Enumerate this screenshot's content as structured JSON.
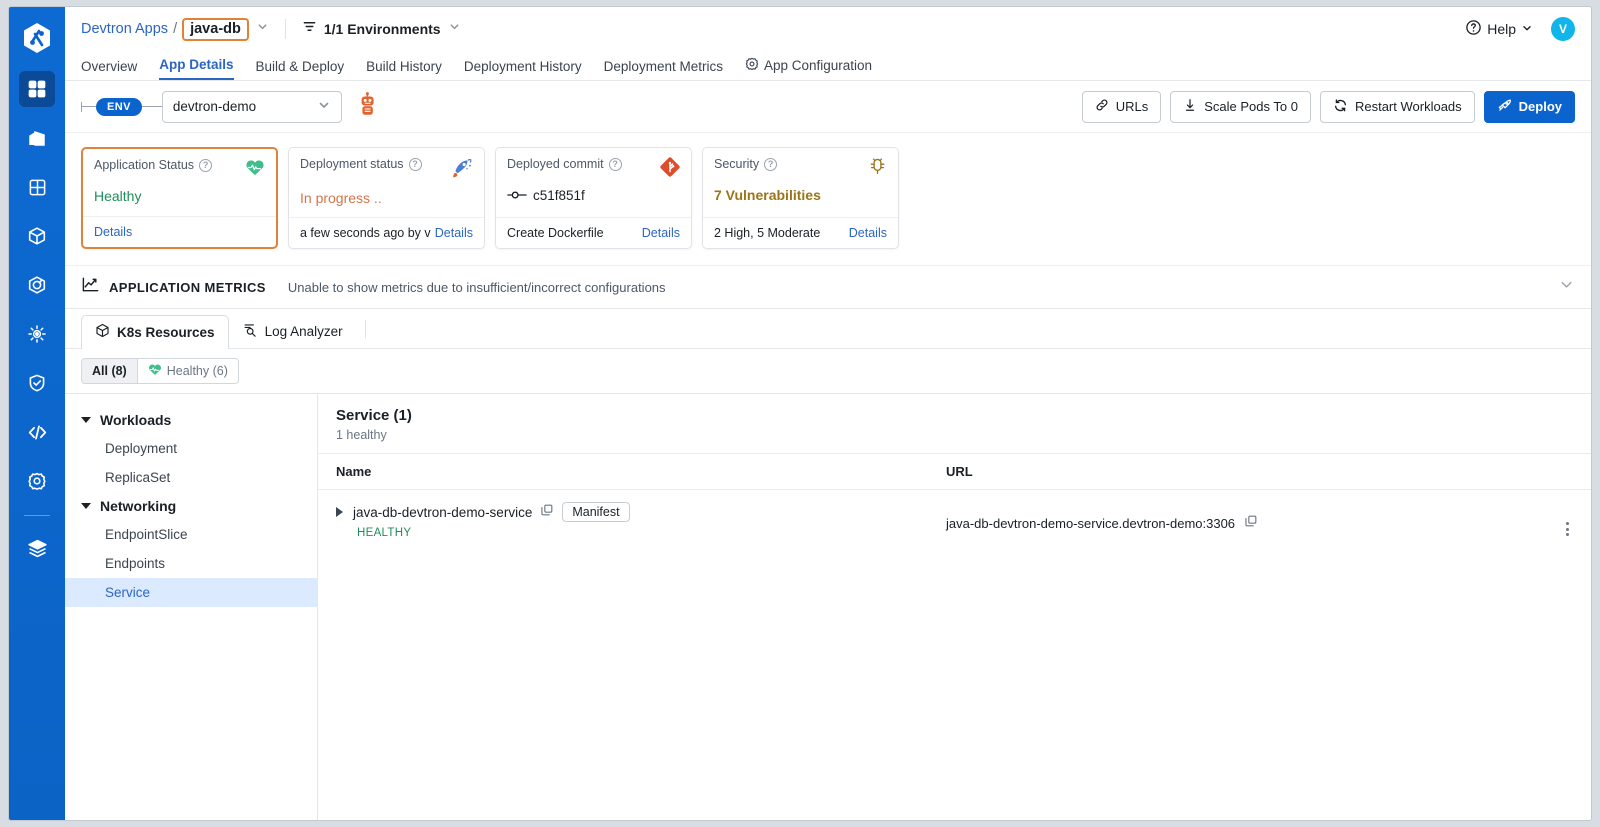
{
  "rail": {
    "logo_icon": "devtron-logo",
    "items": [
      {
        "icon": "apps-grid-icon",
        "name": "applications",
        "active": true
      },
      {
        "icon": "chart-building-icon",
        "name": "jobs",
        "active": false
      },
      {
        "icon": "grid-squares-icon",
        "name": "app-groups",
        "active": false
      },
      {
        "icon": "cube-icon",
        "name": "resource-browser",
        "active": false
      },
      {
        "icon": "target-icon",
        "name": "chart-store",
        "active": false
      },
      {
        "icon": "bug-gear-icon",
        "name": "clusters",
        "active": false
      },
      {
        "icon": "shield-check-icon",
        "name": "security",
        "active": false
      },
      {
        "icon": "code-icon",
        "name": "code",
        "active": false
      },
      {
        "icon": "gear-icon",
        "name": "global-configurations",
        "active": false
      },
      {
        "icon": "layers-icon",
        "name": "stack-manager",
        "active": false
      }
    ]
  },
  "header": {
    "breadcrumb_root": "Devtron Apps",
    "breadcrumb_sep": "/",
    "app_name": "java-db",
    "env_filter": "1/1 Environments",
    "env_filter_icon": "filter-icon",
    "help_label": "Help",
    "help_icon": "question-circle-icon",
    "avatar_initial": "V",
    "highlight_color": "#e0823a"
  },
  "tabs": [
    {
      "label": "Overview",
      "active": false,
      "icon": null
    },
    {
      "label": "App Details",
      "active": true,
      "icon": null
    },
    {
      "label": "Build & Deploy",
      "active": false,
      "icon": null
    },
    {
      "label": "Build History",
      "active": false,
      "icon": null
    },
    {
      "label": "Deployment History",
      "active": false,
      "icon": null
    },
    {
      "label": "Deployment Metrics",
      "active": false,
      "icon": null
    },
    {
      "label": "App Configuration",
      "active": false,
      "icon": "gear-icon"
    }
  ],
  "envbar": {
    "env_pill": "ENV",
    "env_value": "devtron-demo",
    "robot_icon": "robot-icon",
    "buttons": [
      {
        "label": "URLs",
        "icon": "link-icon",
        "primary": false
      },
      {
        "label": "Scale Pods To 0",
        "icon": "scale-down-icon",
        "primary": false
      },
      {
        "label": "Restart Workloads",
        "icon": "refresh-icon",
        "primary": false
      },
      {
        "label": "Deploy",
        "icon": "rocket-icon",
        "primary": true
      }
    ]
  },
  "cards": [
    {
      "label": "Application Status",
      "value": "Healthy",
      "value_class": "green",
      "icon": "heartbeat-icon",
      "footer_text": "",
      "footer_link": "Details",
      "highlighted": true
    },
    {
      "label": "Deployment status",
      "value": "In progress ..",
      "value_class": "orange",
      "icon": "rocket-launch-icon",
      "footer_text": "a few seconds ago  by vishu.go...",
      "footer_link": "Details",
      "highlighted": false
    },
    {
      "label": "Deployed commit",
      "value": "c51f851f",
      "value_class": "mono",
      "icon": "git-icon",
      "footer_text": "Create Dockerfile",
      "footer_link": "Details",
      "highlighted": false
    },
    {
      "label": "Security",
      "value": "7 Vulnerabilities",
      "value_class": "amber",
      "icon": "bug-icon",
      "footer_text": "2 High, 5 Moderate",
      "footer_link": "Details",
      "highlighted": false
    }
  ],
  "metrics": {
    "icon": "graph-line-icon",
    "title": "APPLICATION METRICS",
    "subtitle": "Unable to show metrics due to insufficient/incorrect configurations",
    "collapse_icon": "chevron-down-icon"
  },
  "resource": {
    "tabs": [
      {
        "label": "K8s Resources",
        "icon": "cube-icon",
        "active": true
      },
      {
        "label": "Log Analyzer",
        "icon": "log-search-icon",
        "active": false
      }
    ],
    "filters": [
      {
        "label": "All (8)",
        "icon": null,
        "selected": true
      },
      {
        "label": "Healthy (6)",
        "icon": "heart-icon",
        "selected": false
      }
    ],
    "tree": [
      {
        "type": "group",
        "label": "Workloads",
        "expanded": true
      },
      {
        "type": "item",
        "label": "Deployment",
        "selected": false
      },
      {
        "type": "item",
        "label": "ReplicaSet",
        "selected": false
      },
      {
        "type": "group",
        "label": "Networking",
        "expanded": true
      },
      {
        "type": "item",
        "label": "EndpointSlice",
        "selected": false
      },
      {
        "type": "item",
        "label": "Endpoints",
        "selected": false
      },
      {
        "type": "item",
        "label": "Service",
        "selected": true
      }
    ],
    "detail": {
      "title": "Service (1)",
      "subtitle": "1 healthy",
      "columns": [
        "Name",
        "URL"
      ],
      "rows": [
        {
          "name": "java-db-devtron-demo-service",
          "copy_icon": "copy-icon",
          "manifest_label": "Manifest",
          "status": "HEALTHY",
          "url": "java-db-devtron-demo-service.devtron-demo:3306",
          "url_copy_icon": "copy-icon",
          "menu_icon": "kebab-menu-icon"
        }
      ]
    }
  },
  "colors": {
    "rail_blue": "#0b63cd",
    "link_blue": "#2b66c3",
    "healthy_green": "#1e8e5a",
    "warning_amber": "#9b7518",
    "progress_orange": "#d5744a",
    "highlight_orange": "#e0823a"
  }
}
